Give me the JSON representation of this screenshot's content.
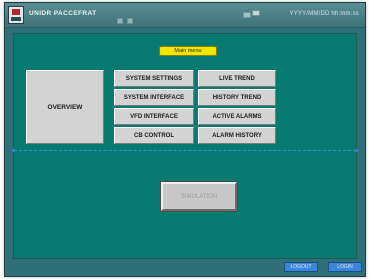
{
  "titlebar": {
    "app_title": "UNIDR  PACCEFRAT",
    "datetime": "YYYY/MM/DD  hh:mm:ss"
  },
  "main": {
    "menu_label": "Main menu",
    "overview_label": "OVERVIEW",
    "buttons": [
      {
        "label": "SYSTEM SETTINGS"
      },
      {
        "label": "LIVE TREND"
      },
      {
        "label": "SYSTEM INTERFACE"
      },
      {
        "label": "HISTORY TREND"
      },
      {
        "label": "VFD INTERFACE"
      },
      {
        "label": "ACTIVE ALARMS"
      },
      {
        "label": "CB CONTROL"
      },
      {
        "label": "ALARM HISTORY"
      }
    ],
    "simulation_label": "SIMULATION"
  },
  "footer": {
    "logout_label": "LOGOUT",
    "login_label": "LOGIN"
  },
  "colors": {
    "background_teal": "#087a72",
    "titlebar": "#3d7279",
    "menu_tag": "#f2e600",
    "footer_button": "#3c86d6"
  }
}
